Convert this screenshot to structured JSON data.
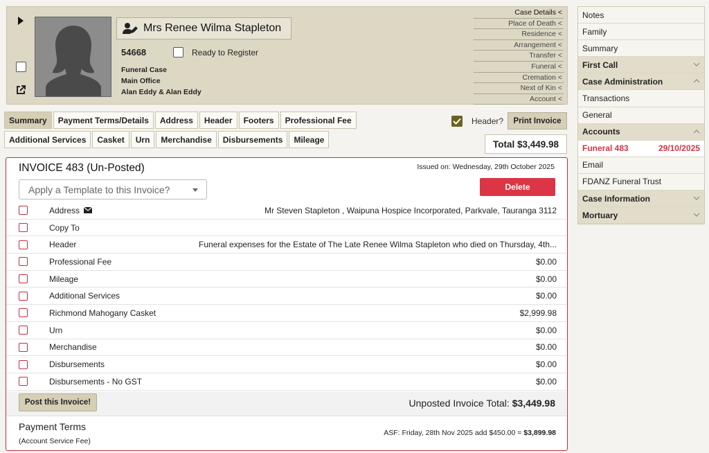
{
  "header": {
    "patient_name": "Mrs Renee Wilma Stapleton",
    "case_number": "54668",
    "ready_to_register": "Ready to Register",
    "case_type": "Funeral Case",
    "office": "Main Office",
    "arrangers": "Alan Eddy & Alan Eddy",
    "case_links": [
      "Case Details <",
      "Place of Death <",
      "Residence <",
      "Arrangement <",
      "Transfer <",
      "Funeral <",
      "Cremation <",
      "Next of Kin <",
      "Account <"
    ]
  },
  "tabs_row1": [
    "Summary",
    "Payment Terms/Details",
    "Address",
    "Header",
    "Footers",
    "Professional Fee"
  ],
  "tabs_row2": [
    "Additional Services",
    "Casket",
    "Urn",
    "Merchandise",
    "Disbursements",
    "Mileage"
  ],
  "toolbar": {
    "header_label": "Header?",
    "print_label": "Print Invoice",
    "total": "Total $3,449.98"
  },
  "invoice": {
    "title": "INVOICE 483 (Un-Posted)",
    "issued": "Issued on: Wednesday, 29th October 2025",
    "template_placeholder": "Apply a Template to this Invoice?",
    "delete_label": "Delete",
    "rows": [
      {
        "label": "Address",
        "value": "Mr Steven Stapleton , Waipuna Hospice Incorporated, Parkvale, Tauranga 3112"
      },
      {
        "label": "Copy To",
        "value": ""
      },
      {
        "label": "Header",
        "value": "Funeral expenses for the Estate of The Late Renee Wilma Stapleton who died on Thursday, 4th..."
      },
      {
        "label": "Professional Fee",
        "value": "$0.00"
      },
      {
        "label": "Mileage",
        "value": "$0.00"
      },
      {
        "label": "Additional Services",
        "value": "$0.00"
      },
      {
        "label": "Richmond Mahogany Casket",
        "value": "$2,999.98"
      },
      {
        "label": "Urn",
        "value": "$0.00"
      },
      {
        "label": "Merchandise",
        "value": "$0.00"
      },
      {
        "label": "Disbursements",
        "value": "$0.00"
      },
      {
        "label": "Disbursements - No GST",
        "value": "$0.00"
      }
    ],
    "post_label": "Post this Invoice!",
    "unposted_label": "Unposted Invoice Total:",
    "unposted_value": "$3,449.98",
    "payment_terms": "Payment Terms",
    "asf_label": "(Account Service Fee)",
    "asf_text": "ASF: Friday, 28th Nov 2025 add $450.00 =",
    "asf_total": "$3,899.98"
  },
  "sidebar": {
    "items": [
      {
        "label": "Notes",
        "kind": "item"
      },
      {
        "label": "Family",
        "kind": "item"
      },
      {
        "label": "Summary",
        "kind": "item"
      },
      {
        "label": "First Call",
        "kind": "section",
        "chevron": "down"
      },
      {
        "label": "Case Administration",
        "kind": "section",
        "chevron": "up"
      },
      {
        "label": "Transactions",
        "kind": "item"
      },
      {
        "label": "General",
        "kind": "item"
      },
      {
        "label": "Accounts",
        "kind": "section",
        "chevron": "up"
      },
      {
        "label": "Funeral 483",
        "kind": "highlight",
        "date": "29/10/2025"
      },
      {
        "label": "Email",
        "kind": "item"
      },
      {
        "label": "FDANZ Funeral Trust",
        "kind": "item"
      },
      {
        "label": "Case Information",
        "kind": "section",
        "chevron": "down"
      },
      {
        "label": "Mortuary",
        "kind": "section",
        "chevron": "down"
      }
    ]
  },
  "colors": {
    "accent": "#c0303e",
    "delete": "#dc3545",
    "panel": "#ddd8c4",
    "highlight_text": "#d63345"
  }
}
